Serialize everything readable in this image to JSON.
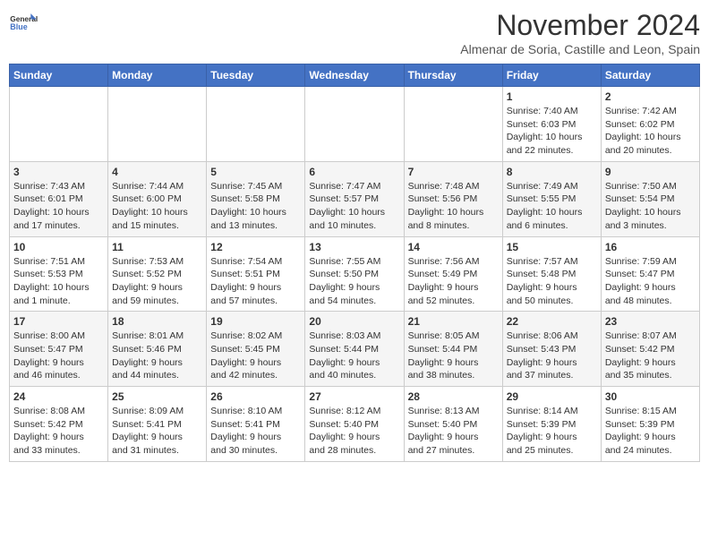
{
  "header": {
    "logo_line1": "General",
    "logo_line2": "Blue",
    "title": "November 2024",
    "subtitle": "Almenar de Soria, Castille and Leon, Spain"
  },
  "calendar": {
    "days_of_week": [
      "Sunday",
      "Monday",
      "Tuesday",
      "Wednesday",
      "Thursday",
      "Friday",
      "Saturday"
    ],
    "weeks": [
      [
        {
          "day": "",
          "detail": ""
        },
        {
          "day": "",
          "detail": ""
        },
        {
          "day": "",
          "detail": ""
        },
        {
          "day": "",
          "detail": ""
        },
        {
          "day": "",
          "detail": ""
        },
        {
          "day": "1",
          "detail": "Sunrise: 7:40 AM\nSunset: 6:03 PM\nDaylight: 10 hours\nand 22 minutes."
        },
        {
          "day": "2",
          "detail": "Sunrise: 7:42 AM\nSunset: 6:02 PM\nDaylight: 10 hours\nand 20 minutes."
        }
      ],
      [
        {
          "day": "3",
          "detail": "Sunrise: 7:43 AM\nSunset: 6:01 PM\nDaylight: 10 hours\nand 17 minutes."
        },
        {
          "day": "4",
          "detail": "Sunrise: 7:44 AM\nSunset: 6:00 PM\nDaylight: 10 hours\nand 15 minutes."
        },
        {
          "day": "5",
          "detail": "Sunrise: 7:45 AM\nSunset: 5:58 PM\nDaylight: 10 hours\nand 13 minutes."
        },
        {
          "day": "6",
          "detail": "Sunrise: 7:47 AM\nSunset: 5:57 PM\nDaylight: 10 hours\nand 10 minutes."
        },
        {
          "day": "7",
          "detail": "Sunrise: 7:48 AM\nSunset: 5:56 PM\nDaylight: 10 hours\nand 8 minutes."
        },
        {
          "day": "8",
          "detail": "Sunrise: 7:49 AM\nSunset: 5:55 PM\nDaylight: 10 hours\nand 6 minutes."
        },
        {
          "day": "9",
          "detail": "Sunrise: 7:50 AM\nSunset: 5:54 PM\nDaylight: 10 hours\nand 3 minutes."
        }
      ],
      [
        {
          "day": "10",
          "detail": "Sunrise: 7:51 AM\nSunset: 5:53 PM\nDaylight: 10 hours\nand 1 minute."
        },
        {
          "day": "11",
          "detail": "Sunrise: 7:53 AM\nSunset: 5:52 PM\nDaylight: 9 hours\nand 59 minutes."
        },
        {
          "day": "12",
          "detail": "Sunrise: 7:54 AM\nSunset: 5:51 PM\nDaylight: 9 hours\nand 57 minutes."
        },
        {
          "day": "13",
          "detail": "Sunrise: 7:55 AM\nSunset: 5:50 PM\nDaylight: 9 hours\nand 54 minutes."
        },
        {
          "day": "14",
          "detail": "Sunrise: 7:56 AM\nSunset: 5:49 PM\nDaylight: 9 hours\nand 52 minutes."
        },
        {
          "day": "15",
          "detail": "Sunrise: 7:57 AM\nSunset: 5:48 PM\nDaylight: 9 hours\nand 50 minutes."
        },
        {
          "day": "16",
          "detail": "Sunrise: 7:59 AM\nSunset: 5:47 PM\nDaylight: 9 hours\nand 48 minutes."
        }
      ],
      [
        {
          "day": "17",
          "detail": "Sunrise: 8:00 AM\nSunset: 5:47 PM\nDaylight: 9 hours\nand 46 minutes."
        },
        {
          "day": "18",
          "detail": "Sunrise: 8:01 AM\nSunset: 5:46 PM\nDaylight: 9 hours\nand 44 minutes."
        },
        {
          "day": "19",
          "detail": "Sunrise: 8:02 AM\nSunset: 5:45 PM\nDaylight: 9 hours\nand 42 minutes."
        },
        {
          "day": "20",
          "detail": "Sunrise: 8:03 AM\nSunset: 5:44 PM\nDaylight: 9 hours\nand 40 minutes."
        },
        {
          "day": "21",
          "detail": "Sunrise: 8:05 AM\nSunset: 5:44 PM\nDaylight: 9 hours\nand 38 minutes."
        },
        {
          "day": "22",
          "detail": "Sunrise: 8:06 AM\nSunset: 5:43 PM\nDaylight: 9 hours\nand 37 minutes."
        },
        {
          "day": "23",
          "detail": "Sunrise: 8:07 AM\nSunset: 5:42 PM\nDaylight: 9 hours\nand 35 minutes."
        }
      ],
      [
        {
          "day": "24",
          "detail": "Sunrise: 8:08 AM\nSunset: 5:42 PM\nDaylight: 9 hours\nand 33 minutes."
        },
        {
          "day": "25",
          "detail": "Sunrise: 8:09 AM\nSunset: 5:41 PM\nDaylight: 9 hours\nand 31 minutes."
        },
        {
          "day": "26",
          "detail": "Sunrise: 8:10 AM\nSunset: 5:41 PM\nDaylight: 9 hours\nand 30 minutes."
        },
        {
          "day": "27",
          "detail": "Sunrise: 8:12 AM\nSunset: 5:40 PM\nDaylight: 9 hours\nand 28 minutes."
        },
        {
          "day": "28",
          "detail": "Sunrise: 8:13 AM\nSunset: 5:40 PM\nDaylight: 9 hours\nand 27 minutes."
        },
        {
          "day": "29",
          "detail": "Sunrise: 8:14 AM\nSunset: 5:39 PM\nDaylight: 9 hours\nand 25 minutes."
        },
        {
          "day": "30",
          "detail": "Sunrise: 8:15 AM\nSunset: 5:39 PM\nDaylight: 9 hours\nand 24 minutes."
        }
      ]
    ]
  }
}
